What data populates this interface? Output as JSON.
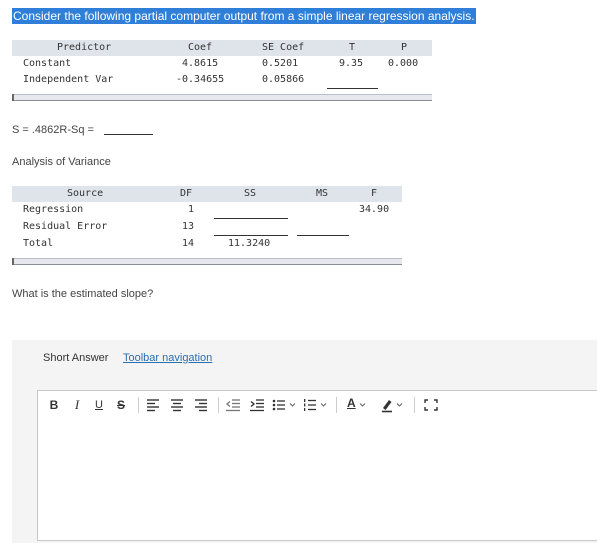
{
  "question_intro": "Consider the following partial computer output from a simple linear regression analysis.",
  "coef_table": {
    "headers": [
      "Predictor",
      "Coef",
      "SE Coef",
      "T",
      "P"
    ],
    "rows": [
      [
        "Constant",
        "4.8615",
        "0.5201",
        "9.35",
        "0.000"
      ],
      [
        "Independent Var",
        "-0.34655",
        "0.05866",
        "",
        ""
      ]
    ]
  },
  "s_line": "S = .4862R-Sq = ",
  "anova_title": "Analysis of Variance",
  "anova_table": {
    "headers": [
      "Source",
      "DF",
      "SS",
      "MS",
      "F"
    ],
    "rows": [
      [
        "Regression",
        "1",
        "",
        "",
        "34.90"
      ],
      [
        "Residual Error",
        "13",
        "",
        "",
        ""
      ],
      [
        "Total",
        "14",
        "11.3240",
        "",
        ""
      ]
    ]
  },
  "question": "What is the estimated slope?",
  "answer_panel": {
    "label": "Short Answer",
    "toolbar_link": "Toolbar navigation"
  },
  "toolbar": {
    "bold": "B",
    "italic": "I",
    "underline": "U",
    "strike": "S",
    "font_color": "A"
  },
  "colors": {
    "highlight": "#2f7fd8",
    "table_header": "#dfe3ea",
    "link": "#2a6fb3"
  }
}
